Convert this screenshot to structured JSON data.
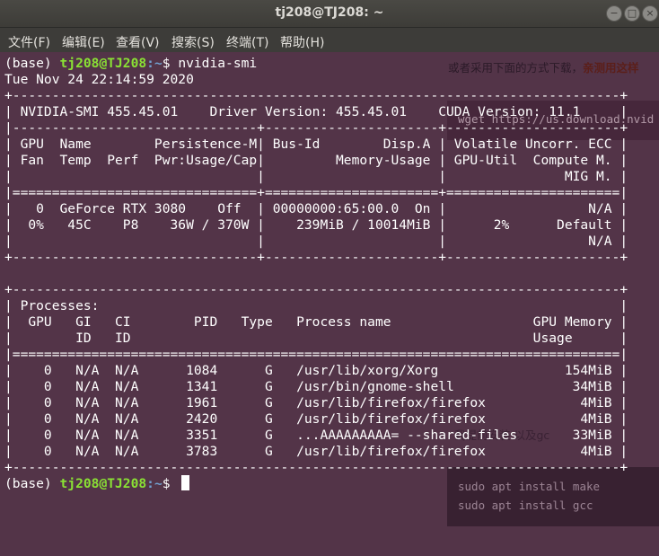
{
  "window": {
    "title": "tj208@TJ208: ~",
    "buttons": {
      "minimize": "−",
      "maximize": "□",
      "close": "×"
    }
  },
  "menu": [
    "文件(F)",
    "编辑(E)",
    "查看(V)",
    "搜索(S)",
    "终端(T)",
    "帮助(H)"
  ],
  "terminal": {
    "prompt_env": "(base) ",
    "prompt_user": "tj208@TJ208",
    "prompt_path": ":~",
    "command": "$ nvidia-smi",
    "final_prompt_suffix": "$ ",
    "output": "Tue Nov 24 22:14:59 2020\n+-----------------------------------------------------------------------------+\n| NVIDIA-SMI 455.45.01    Driver Version: 455.45.01    CUDA Version: 11.1     |\n|-------------------------------+----------------------+----------------------+\n| GPU  Name        Persistence-M| Bus-Id        Disp.A | Volatile Uncorr. ECC |\n| Fan  Temp  Perf  Pwr:Usage/Cap|         Memory-Usage | GPU-Util  Compute M. |\n|                               |                      |               MIG M. |\n|===============================+======================+======================|\n|   0  GeForce RTX 3080    Off  | 00000000:65:00.0  On |                  N/A |\n|  0%   45C    P8    36W / 370W |    239MiB / 10014MiB |      2%      Default |\n|                               |                      |                  N/A |\n+-------------------------------+----------------------+----------------------+\n\n+-----------------------------------------------------------------------------+\n| Processes:                                                                  |\n|  GPU   GI   CI        PID   Type   Process name                  GPU Memory |\n|        ID   ID                                                   Usage      |\n|=============================================================================|\n|    0   N/A  N/A      1084      G   /usr/lib/xorg/Xorg                154MiB |\n|    0   N/A  N/A      1341      G   /usr/bin/gnome-shell               34MiB |\n|    0   N/A  N/A      1961      G   /usr/lib/firefox/firefox            4MiB |\n|    0   N/A  N/A      2420      G   /usr/lib/firefox/firefox            4MiB |\n|    0   N/A  N/A      3351      G   ...AAAAAAAAA= --shared-files       33MiB |\n|    0   N/A  N/A      3783      G   /usr/lib/firefox/firefox            4MiB |\n+-----------------------------------------------------------------------------+"
  },
  "background_overlay": {
    "line1_prefix": "或者采用下面的方式下载，",
    "line1_bold": "亲测用这样",
    "wget": "wget https://us.download.nvid",
    "mid": "我提前安装        以及gc",
    "make": "sudo apt install make",
    "gcc": "sudo apt install gcc"
  }
}
